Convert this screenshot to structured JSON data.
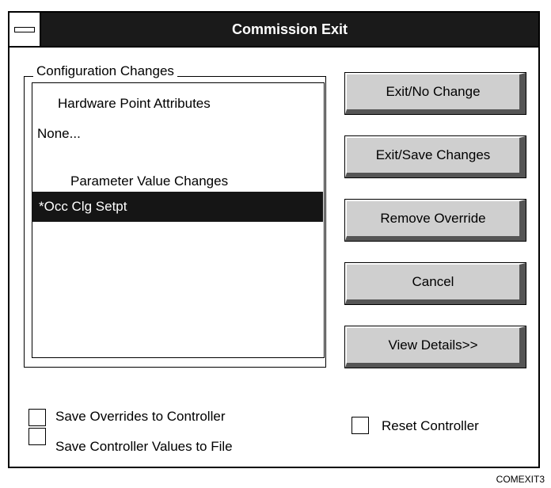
{
  "window": {
    "title": "Commission Exit"
  },
  "group": {
    "label": "Configuration Changes"
  },
  "list": {
    "hardware_heading": "Hardware Point Attributes",
    "hardware_value": "None...",
    "parameter_heading": "Parameter Value Changes",
    "selected_item": "*Occ Clg Setpt"
  },
  "buttons": {
    "exit_no_change": "Exit/No Change",
    "exit_save_changes": "Exit/Save Changes",
    "remove_override": "Remove Override",
    "cancel": "Cancel",
    "view_details": "View Details>>"
  },
  "checkboxes": {
    "save_overrides": "Save Overrides to Controller",
    "save_values": "Save Controller Values to File",
    "reset_controller": "Reset Controller"
  },
  "figure_tag": "COMEXIT3"
}
